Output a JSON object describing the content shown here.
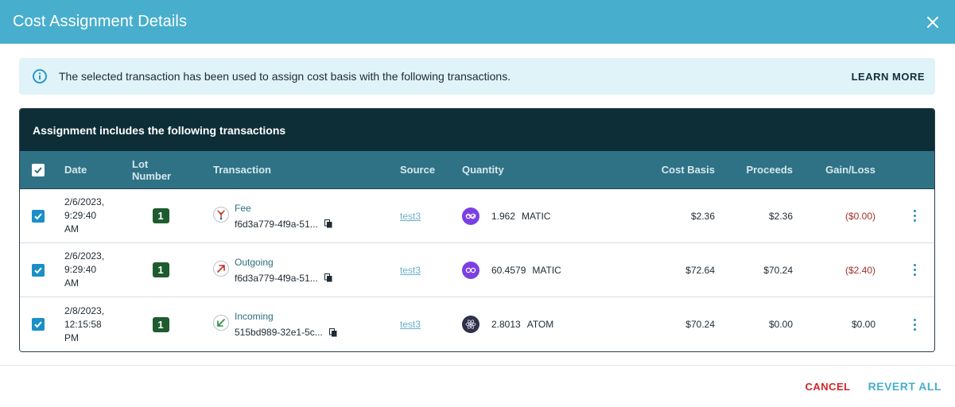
{
  "dialog": {
    "title": "Cost Assignment Details"
  },
  "banner": {
    "text": "The selected transaction has been used to assign cost basis with the following transactions.",
    "learn_more": "LEARN MORE"
  },
  "table": {
    "caption": "Assignment includes the following transactions",
    "headers": {
      "date": "Date",
      "lot": "Lot Number",
      "transaction": "Transaction",
      "source": "Source",
      "quantity": "Quantity",
      "cost_basis": "Cost Basis",
      "proceeds": "Proceeds",
      "gain_loss": "Gain/Loss"
    },
    "rows": [
      {
        "checked": true,
        "date": "2/6/2023,\n9:29:40\nAM",
        "lot": "1",
        "tx_type": "Fee",
        "tx_icon": "fee-icon",
        "tx_hash": "f6d3a779-4f9a-51...",
        "source": "test3",
        "coin_icon": "matic-icon",
        "quantity": "1.962",
        "asset": "MATIC",
        "cost_basis": "$2.36",
        "proceeds": "$2.36",
        "gain_loss": "($0.00)",
        "gain_negative": true
      },
      {
        "checked": true,
        "date": "2/6/2023,\n9:29:40\nAM",
        "lot": "1",
        "tx_type": "Outgoing",
        "tx_icon": "outgoing-arrow-icon",
        "tx_hash": "f6d3a779-4f9a-51...",
        "source": "test3",
        "coin_icon": "matic-icon",
        "quantity": "60.4579",
        "asset": "MATIC",
        "cost_basis": "$72.64",
        "proceeds": "$70.24",
        "gain_loss": "($2.40)",
        "gain_negative": true
      },
      {
        "checked": true,
        "date": "2/8/2023,\n12:15:58\nPM",
        "lot": "1",
        "tx_type": "Incoming",
        "tx_icon": "incoming-arrow-icon",
        "tx_hash": "515bd989-32e1-5c...",
        "source": "test3",
        "coin_icon": "atom-icon",
        "quantity": "2.8013",
        "asset": "ATOM",
        "cost_basis": "$70.24",
        "proceeds": "$0.00",
        "gain_loss": "$0.00",
        "gain_negative": false
      }
    ]
  },
  "footer": {
    "cancel": "CANCEL",
    "revert_all": "REVERT ALL"
  },
  "colors": {
    "header_bar": "#48aecd",
    "banner_bg": "#dff3f9",
    "caption_bg": "#0d2d37",
    "thead_bg": "#2f7286",
    "lot_badge": "#1e5b2e",
    "negative": "#a0302a",
    "cancel": "#d4262c",
    "matic": "#7b3fe4",
    "atom": "#2e3148"
  }
}
